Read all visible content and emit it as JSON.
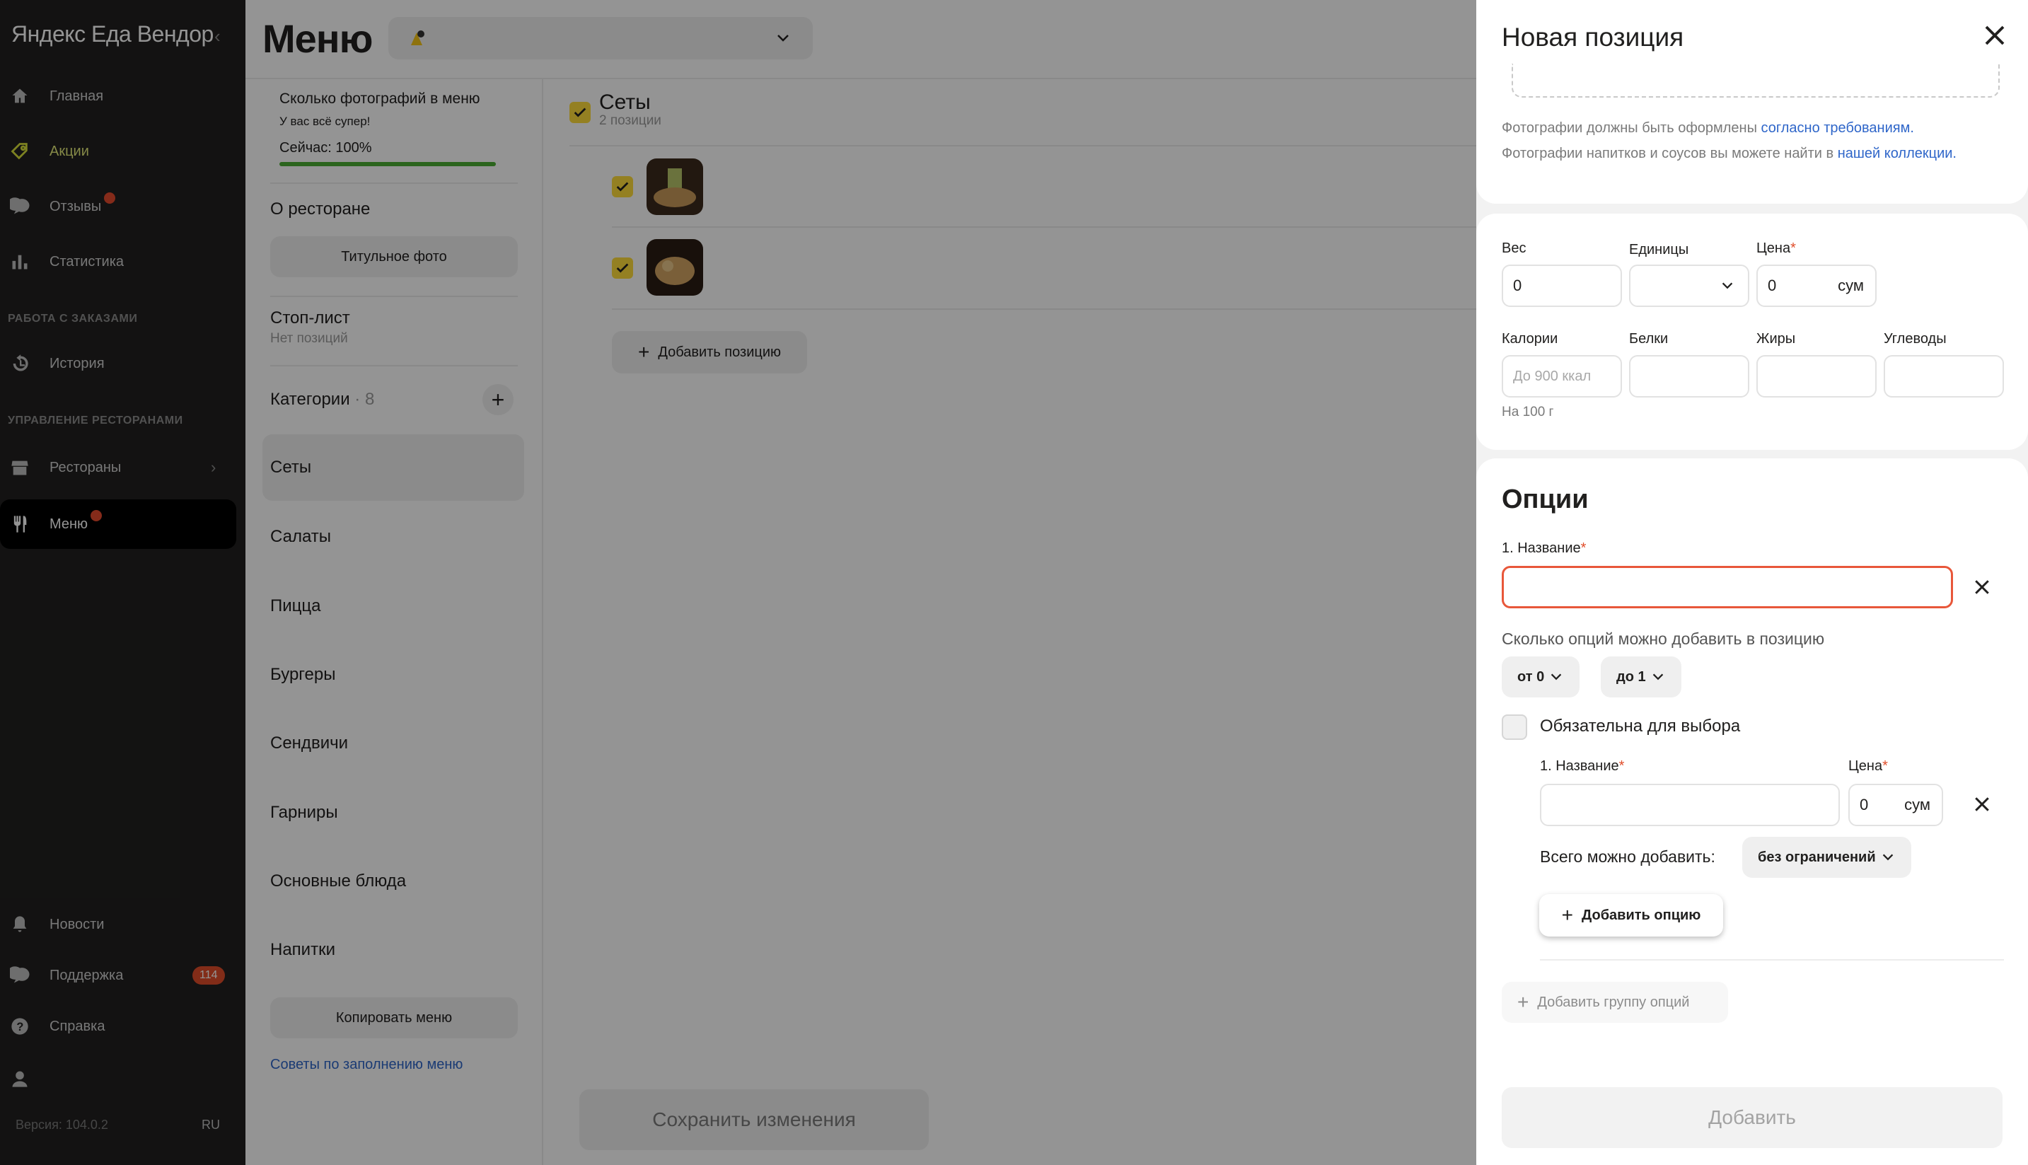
{
  "sidebar": {
    "brand": "Яндекс Еда Вендор",
    "items": [
      {
        "label": "Главная",
        "icon": "home-icon"
      },
      {
        "label": "Акции",
        "icon": "tag-icon"
      },
      {
        "label": "Отзывы",
        "icon": "chat-icon"
      },
      {
        "label": "Статистика",
        "icon": "chart-icon"
      },
      {
        "label": "История",
        "icon": "history-icon"
      },
      {
        "label": "Рестораны",
        "icon": "store-icon"
      },
      {
        "label": "Меню",
        "icon": "fork-knife-icon"
      },
      {
        "label": "Новости",
        "icon": "bell-icon"
      },
      {
        "label": "Поддержка",
        "icon": "support-chat-icon"
      },
      {
        "label": "Справка",
        "icon": "help-icon"
      }
    ],
    "section_orders": "РАБОТА С ЗАКАЗАМИ",
    "section_restaurants": "УПРАВЛЕНИЕ РЕСТОРАНАМИ",
    "support_badge": "114",
    "version": "Версия: 104.0.2",
    "lang": "RU",
    "accent": "#e04d2a"
  },
  "main": {
    "title": "Меню",
    "photos": {
      "title": "Сколько фотографий в меню",
      "subtitle": "У вас всё супер!",
      "current": "Сейчас: 100%",
      "progress": 1.0
    },
    "about_title": "О ресторане",
    "title_photo_btn": "Титульное фото",
    "stoplist_title": "Стоп-лист",
    "stoplist_sub": "Нет позиций",
    "categories_title": "Категории",
    "categories_count": "· 8",
    "categories": [
      "Сеты",
      "Салаты",
      "Пицца",
      "Бургеры",
      "Сендвичи",
      "Гарниры",
      "Основные блюда",
      "Напитки"
    ],
    "copy_menu_btn": "Копировать меню",
    "tips_link": "Советы по заполнению меню",
    "sets_title": "Сеты",
    "sets_sub": "2 позиции",
    "add_position_btn": "Добавить позицию",
    "save_btn": "Сохранить изменения"
  },
  "panel": {
    "title": "Новая позиция",
    "photo_req_text": "Фотографии должны быть оформлены ",
    "photo_req_link": "согласно требованиям.",
    "photo_col_text": "Фотографии напитков и соусов вы можете найти в ",
    "photo_col_link": "нашей коллекции.",
    "weight_label": "Вес",
    "weight_value": "0",
    "units_label": "Единицы",
    "price_label": "Цена",
    "price_value": "0",
    "currency": "сум",
    "calories_label": "Калории",
    "calories_placeholder": "До 900 ккал",
    "proteins_label": "Белки",
    "fats_label": "Жиры",
    "carbs_label": "Углеводы",
    "per_100": "На 100 г",
    "options_title": "Опции",
    "group_name_label": "1. Название",
    "how_many_label": "Сколько опций можно добавить в позицию",
    "from_value": "от 0",
    "to_value": "до 1",
    "required_label": "Обязательна для выбора",
    "option_name_label": "1. Название",
    "option_price_label": "Цена",
    "option_price_value": "0",
    "total_label": "Всего можно добавить:",
    "total_value": "без ограничений",
    "add_option_btn": "Добавить опцию",
    "add_group_btn": "Добавить группу опций",
    "add_btn": "Добавить"
  }
}
